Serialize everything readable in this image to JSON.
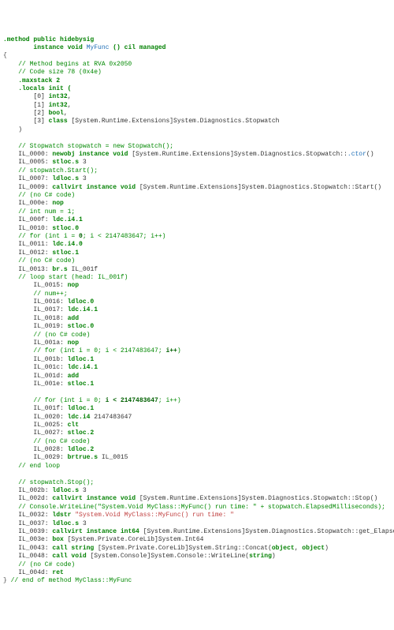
{
  "sig1": ".method public hidebysig",
  "sig2_pre": "instance void ",
  "sig2_name": "MyFunc",
  "sig2_post": " () cil managed",
  "brace_open": "{",
  "c_begins": "    // Method begins at RVA 0x2050",
  "c_size": "    // Code size 78 (0x4e)",
  "maxstack": "    .maxstack 2",
  "locals": "    .locals init (",
  "loc0_pre": "        [0] ",
  "loc0_t": "int32",
  "loc0_c": ",",
  "loc1_pre": "        [1] ",
  "loc1_t": "int32",
  "loc1_c": ",",
  "loc2_pre": "        [2] ",
  "loc2_t": "bool",
  "loc2_c": ",",
  "loc3_pre": "        [3] ",
  "loc3_kw": "class ",
  "loc3_t": "[System.Runtime.Extensions]System.Diagnostics.Stopwatch",
  "loc_close": "    )",
  "blank1": "",
  "c_sw_new": "    // Stopwatch stopwatch = new Stopwatch();",
  "i0000": "    IL_0000: ",
  "i0000_op": "newobj instance void ",
  "i0000_t": "[System.Runtime.Extensions]System.Diagnostics.Stopwatch::",
  "i0000_m": ".ctor",
  "i0000_p": "()",
  "i0005": "    IL_0005: ",
  "i0005_op": "stloc.s ",
  "i0005_v": "3",
  "c_sw_start": "    // stopwatch.Start();",
  "i0007": "    IL_0007: ",
  "i0007_op": "ldloc.s ",
  "i0007_v": "3",
  "i0009": "    IL_0009: ",
  "i0009_op": "callvirt instance void ",
  "i0009_t": "[System.Runtime.Extensions]System.Diagnostics.Stopwatch::Start()",
  "c_nocs1": "    // (no C# code)",
  "i000e": "    IL_000e: ",
  "i000e_op": "nop",
  "c_num": "    // int num = 1;",
  "i000f": "    IL_000f: ",
  "i000f_op": "ldc.i4.1",
  "i0010": "    IL_0010: ",
  "i0010_op": "stloc.0",
  "c_forA": "    // for (int i = ",
  "c_forB": "0",
  "c_forC": "; i < 2147483647; i++)",
  "i0011": "    IL_0011: ",
  "i0011_op": "ldc.i4.0",
  "i0012": "    IL_0012: ",
  "i0012_op": "stloc.1",
  "c_nocs2": "    // (no C# code)",
  "i0013": "    IL_0013: ",
  "i0013_op": "br.s ",
  "i0013_t": "IL_001f",
  "c_loop": "    // loop start (head: IL_001f)",
  "i0015": "        IL_0015: ",
  "i0015_op": "nop",
  "c_numpp": "        // num++;",
  "i0016": "        IL_0016: ",
  "i0016_op": "ldloc.0",
  "i0017": "        IL_0017: ",
  "i0017_op": "ldc.i4.1",
  "i0018": "        IL_0018: ",
  "i0018_op": "add",
  "i0019": "        IL_0019: ",
  "i0019_op": "stloc.0",
  "c_nocs3": "        // (no C# code)",
  "i001a": "        IL_001a: ",
  "i001a_op": "nop",
  "c_for2A": "        // for (int i = 0; i < 2147483647; ",
  "c_for2B": "i++",
  "c_for2C": ")",
  "i001b": "        IL_001b: ",
  "i001b_op": "ldloc.1",
  "i001c": "        IL_001c: ",
  "i001c_op": "ldc.i4.1",
  "i001d": "        IL_001d: ",
  "i001d_op": "add",
  "i001e": "        IL_001e: ",
  "i001e_op": "stloc.1",
  "blank2": "",
  "c_for3A": "        // for (int i = 0; ",
  "c_for3B": "i < 2147483647",
  "c_for3C": "; i++)",
  "i001f": "        IL_001f: ",
  "i001f_op": "ldloc.1",
  "i0020": "        IL_0020: ",
  "i0020_op": "ldc.i4 ",
  "i0020_v": "2147483647",
  "i0025": "        IL_0025: ",
  "i0025_op": "clt",
  "i0027": "        IL_0027: ",
  "i0027_op": "stloc.2",
  "c_nocs4": "        // (no C# code)",
  "i0028": "        IL_0028: ",
  "i0028_op": "ldloc.2",
  "i0029": "        IL_0029: ",
  "i0029_op": "brtrue.s ",
  "i0029_t": "IL_0015",
  "c_endloop": "    // end loop",
  "blank3": "",
  "c_stop": "    // stopwatch.Stop();",
  "i002b": "    IL_002b: ",
  "i002b_op": "ldloc.s ",
  "i002b_v": "3",
  "i002d": "    IL_002d: ",
  "i002d_op": "callvirt instance void ",
  "i002d_t": "[System.Runtime.Extensions]System.Diagnostics.Stopwatch::Stop()",
  "c_write": "    // Console.WriteLine(\"System.Void MyClass::MyFunc() run time: \" + stopwatch.ElapsedMilliseconds);",
  "i0032": "    IL_0032: ",
  "i0032_op": "ldstr ",
  "i0032_s": "\"System.Void MyClass::MyFunc() run time: \"",
  "i0037": "    IL_0037: ",
  "i0037_op": "ldloc.s ",
  "i0037_v": "3",
  "i0039": "    IL_0039: ",
  "i0039_op": "callvirt instance int64 ",
  "i0039_t": "[System.Runtime.Extensions]System.Diagnostics.Stopwatch::get_ElapsedMilliseconds()",
  "i003e": "    IL_003e: ",
  "i003e_op": "box ",
  "i003e_t": "[System.Private.CoreLib]System.Int64",
  "i0043": "    IL_0043: ",
  "i0043_op": "call string ",
  "i0043_t": "[System.Private.CoreLib]System.String::Concat(",
  "i0043_a": "object",
  "i0043_c": ", ",
  "i0043_a2": "object",
  "i0043_p": ")",
  "i0048": "    IL_0048: ",
  "i0048_op": "call void ",
  "i0048_t": "[System.Console]System.Console::WriteLine(",
  "i0048_a": "string",
  "i0048_p": ")",
  "c_nocs5": "    // (no C# code)",
  "i004d": "    IL_004d: ",
  "i004d_op": "ret",
  "brace_close": "} ",
  "c_end": "// end of method MyClass::MyFunc"
}
